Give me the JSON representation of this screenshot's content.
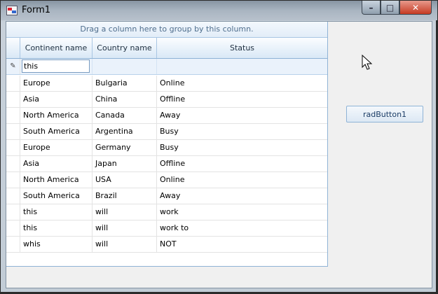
{
  "window": {
    "title": "Form1",
    "minimize_glyph": "–",
    "maximize_glyph": "□",
    "close_glyph": "✕"
  },
  "grid": {
    "group_panel_text": "Drag a column here to group by this column.",
    "columns": [
      "Continent name",
      "Country name",
      "Status"
    ],
    "edit_row": {
      "indicator_icon": "pencil-icon",
      "indicator_glyph": "✎",
      "value": "this"
    },
    "rows": [
      [
        "Europe",
        "Bulgaria",
        "Online"
      ],
      [
        "Asia",
        "China",
        "Offline"
      ],
      [
        "North America",
        "Canada",
        "Away"
      ],
      [
        "South America",
        "Argentina",
        "Busy"
      ],
      [
        "Europe",
        "Germany",
        "Busy"
      ],
      [
        "Asia",
        "Japan",
        "Offline"
      ],
      [
        "North America",
        "USA",
        "Online"
      ],
      [
        "South America",
        "Brazil",
        "Away"
      ],
      [
        "this",
        "will",
        "work"
      ],
      [
        "this",
        "will",
        "work to"
      ],
      [
        "whis",
        "will",
        "NOT"
      ]
    ]
  },
  "button": {
    "label": "radButton1"
  },
  "icons": {
    "app_icon": "form-app-icon",
    "cursor": "mouse-pointer-icon"
  }
}
